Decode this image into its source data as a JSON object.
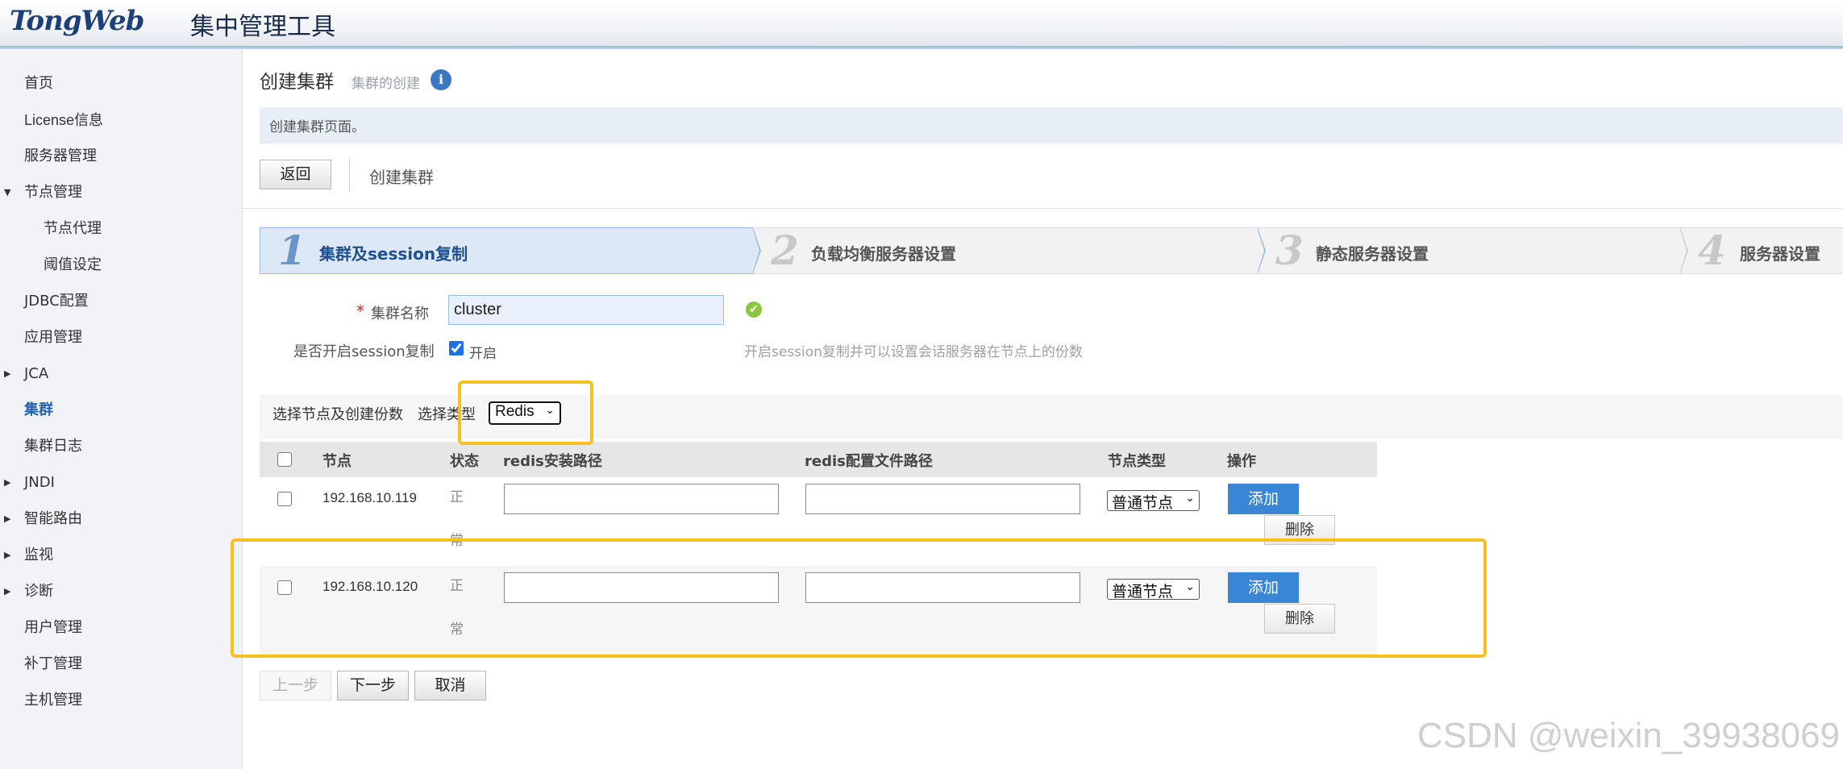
{
  "header": {
    "brand": "TongWeb",
    "title": "集中管理工具"
  },
  "sidebar": {
    "items": [
      {
        "label": "首页"
      },
      {
        "label": "License信息"
      },
      {
        "label": "服务器管理"
      },
      {
        "label": "节点管理"
      },
      {
        "label": "节点代理"
      },
      {
        "label": "阈值设定"
      },
      {
        "label": "JDBC配置"
      },
      {
        "label": "应用管理"
      },
      {
        "label": "JCA"
      },
      {
        "label": "集群"
      },
      {
        "label": "集群日志"
      },
      {
        "label": "JNDI"
      },
      {
        "label": "智能路由"
      },
      {
        "label": "监视"
      },
      {
        "label": "诊断"
      },
      {
        "label": "用户管理"
      },
      {
        "label": "补丁管理"
      },
      {
        "label": "主机管理"
      }
    ]
  },
  "page": {
    "title": "创建集群",
    "subtitle": "集群的创建",
    "info_icon": "i",
    "description": "创建集群页面。",
    "back_label": "返回",
    "breadcrumb": "创建集群"
  },
  "steps": [
    {
      "number": "1",
      "label": "集群及session复制"
    },
    {
      "number": "2",
      "label": "负载均衡服务器设置"
    },
    {
      "number": "3",
      "label": "静态服务器设置"
    },
    {
      "number": "4",
      "label": "服务器设置"
    }
  ],
  "form": {
    "required_mark": "*",
    "cluster_name_label": "集群名称",
    "cluster_name_value": "cluster",
    "session_label": "是否开启session复制",
    "session_checkbox_label": "开启",
    "session_enabled": true,
    "session_hint": "开启session复制并可以设置会话服务器在节点上的份数"
  },
  "node_selection": {
    "label": "选择节点及创建份数",
    "type_label": "选择类型",
    "type_value": "Redis"
  },
  "table": {
    "headers": [
      "节点",
      "状态",
      "redis安装路径",
      "redis配置文件路径",
      "节点类型",
      "操作"
    ],
    "rows": [
      {
        "ip": "192.168.10.119",
        "status": "正常",
        "install_path": "",
        "config_path": "",
        "node_type": "普通节点",
        "add": "添加",
        "delete": "删除"
      },
      {
        "ip": "192.168.10.120",
        "status": "正常",
        "install_path": "",
        "config_path": "",
        "node_type": "普通节点",
        "add": "添加",
        "delete": "删除"
      }
    ]
  },
  "footer": {
    "prev_label": "上一步",
    "next_label": "下一步",
    "cancel_label": "取消"
  },
  "watermark": "CSDN @weixin_39938069",
  "colors": {
    "accent": "#3a86d6",
    "highlight": "#f5c022",
    "step_active_bg": "#dce8f6"
  }
}
